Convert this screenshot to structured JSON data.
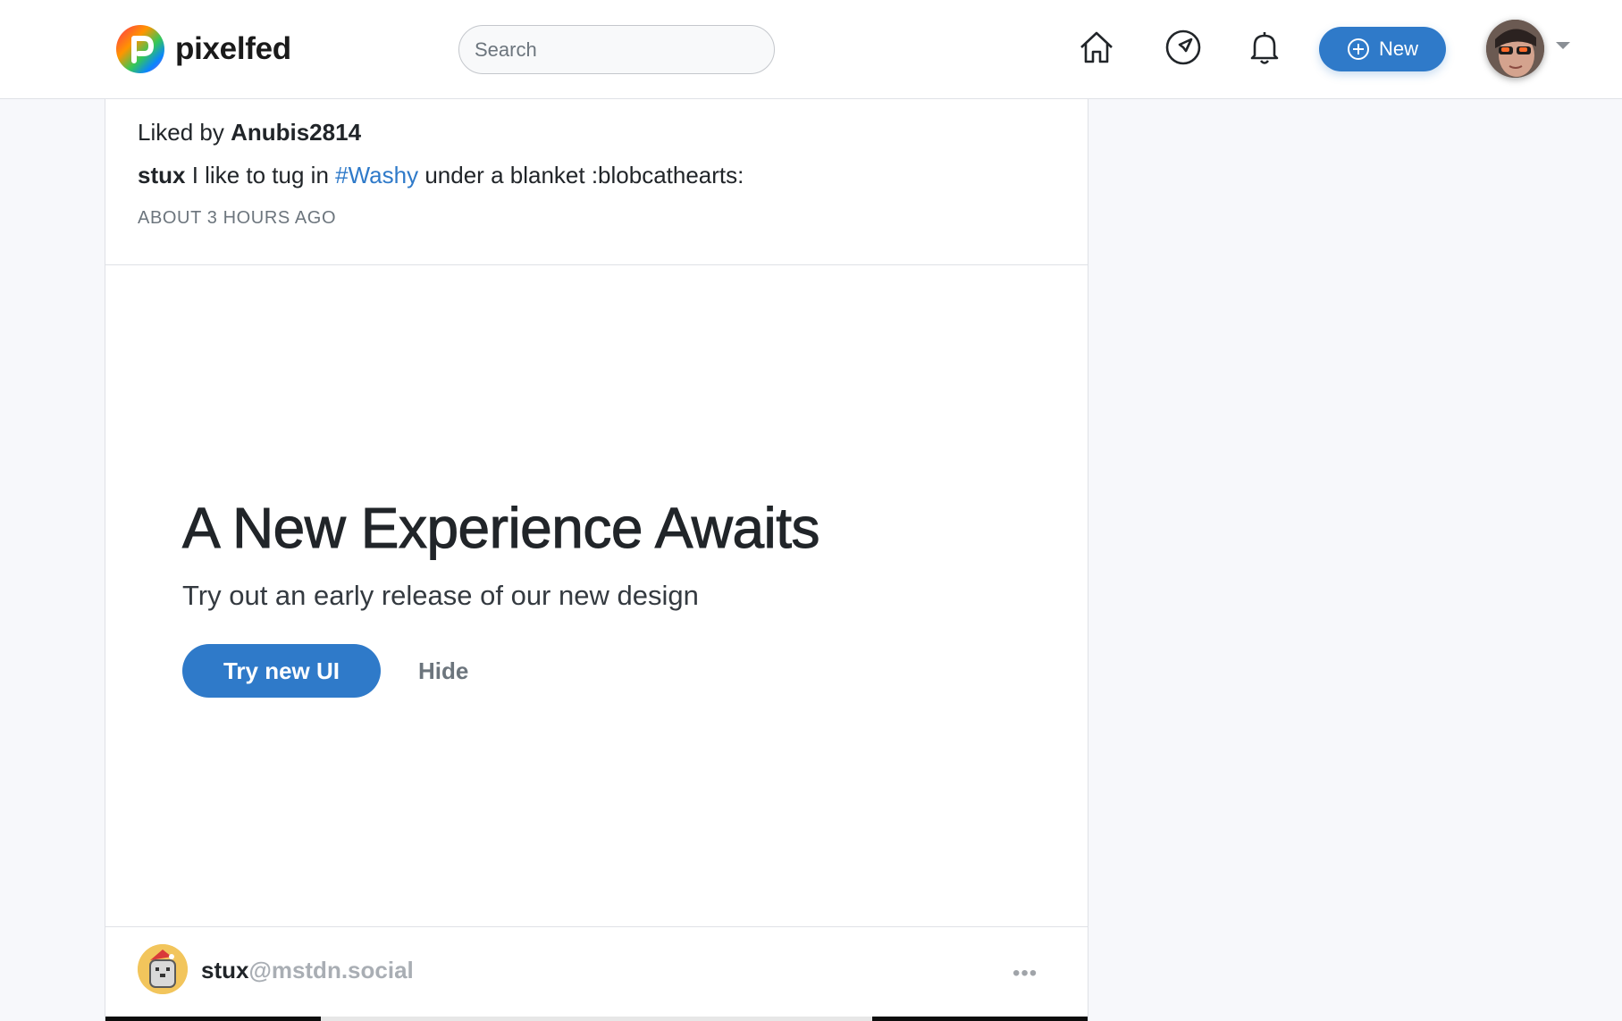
{
  "brand": {
    "name": "pixelfed"
  },
  "search": {
    "placeholder": "Search"
  },
  "nav": {
    "home_icon": "home-icon",
    "explore_icon": "compass-icon",
    "notifications_icon": "bell-icon",
    "new_label": "New"
  },
  "post": {
    "liked_prefix": "Liked by",
    "liked_user": "Anubis2814",
    "caption_user": "stux",
    "caption_before": "I like to tug in",
    "caption_tag": "#Washy",
    "caption_after": "under a blanket :blobcathearts:",
    "timestamp": "ABOUT 3 HOURS AGO"
  },
  "promo": {
    "title": "A New Experience Awaits",
    "subtitle": "Try out an early release of our new design",
    "try_label": "Try new UI",
    "hide_label": "Hide"
  },
  "next_post": {
    "username": "stux",
    "instance": "@mstdn.social",
    "more_label": "•••"
  },
  "colors": {
    "accent": "#2f7ac9",
    "muted": "#6c757d",
    "background": "#f7f8fb"
  }
}
